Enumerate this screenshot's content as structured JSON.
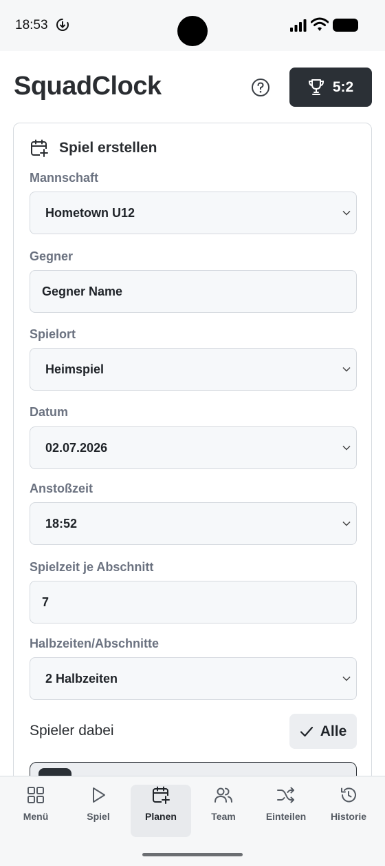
{
  "status": {
    "time": "18:53"
  },
  "header": {
    "app_title": "SquadClock",
    "score": "5:2"
  },
  "card": {
    "title": "Spiel erstellen",
    "fields": [
      {
        "label": "Mannschaft",
        "value": "Hometown U12",
        "type": "select"
      },
      {
        "label": "Gegner",
        "value": "Gegner Name",
        "type": "input"
      },
      {
        "label": "Spielort",
        "value": "Heimspiel",
        "type": "select"
      },
      {
        "label": "Datum",
        "value": "02.07.2026",
        "type": "select"
      },
      {
        "label": "Anstoßzeit",
        "value": "18:52",
        "type": "select"
      },
      {
        "label": "Spielzeit je Abschnitt",
        "value": "7",
        "type": "input"
      },
      {
        "label": "Halbzeiten/Abschnitte",
        "value": "2 Halbzeiten",
        "type": "select"
      }
    ],
    "players_label": "Spieler dabei",
    "all_button": "Alle"
  },
  "nav": [
    {
      "label": "Menü",
      "icon": "grid-icon"
    },
    {
      "label": "Spiel",
      "icon": "play-icon"
    },
    {
      "label": "Planen",
      "icon": "calendar-plus-icon",
      "active": true
    },
    {
      "label": "Team",
      "icon": "users-icon"
    },
    {
      "label": "Einteilen",
      "icon": "shuffle-icon"
    },
    {
      "label": "Historie",
      "icon": "history-icon"
    }
  ]
}
